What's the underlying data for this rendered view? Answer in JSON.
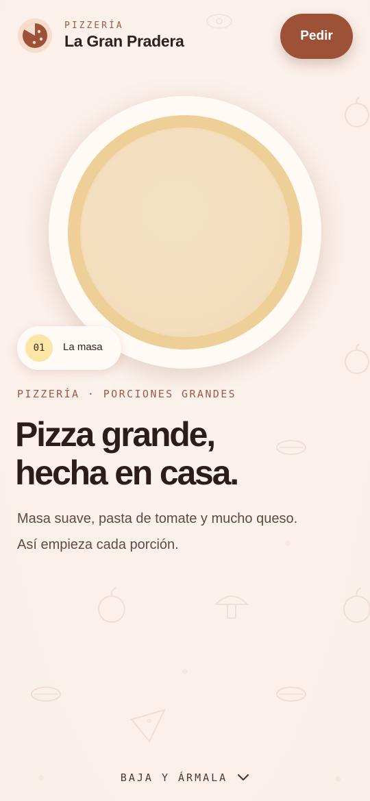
{
  "header": {
    "kicker": "PIZZERÍA",
    "brand_name": "La Gran Pradera",
    "order_button": "Pedir",
    "logo_icon": "pizza-slice-icon"
  },
  "hero": {
    "step": {
      "number": "01",
      "label": "La masa"
    },
    "kicker": "PIZZERÍA · PORCIONES GRANDES",
    "headline_lines": [
      "Pizza grande,",
      "hecha en casa."
    ],
    "subtitle_lines": [
      "Masa suave, pasta de tomate y mucho queso.",
      "Así empieza cada porción."
    ]
  },
  "scroll_hint": {
    "label": "BAJA Y ÁRMALA",
    "icon": "chevron-down-icon"
  },
  "colors": {
    "accent": "#9d5238",
    "background": "#fbf1ec",
    "text": "#2b1d17",
    "kicker": "#a3573b",
    "step_badge": "#fbe6a6"
  }
}
